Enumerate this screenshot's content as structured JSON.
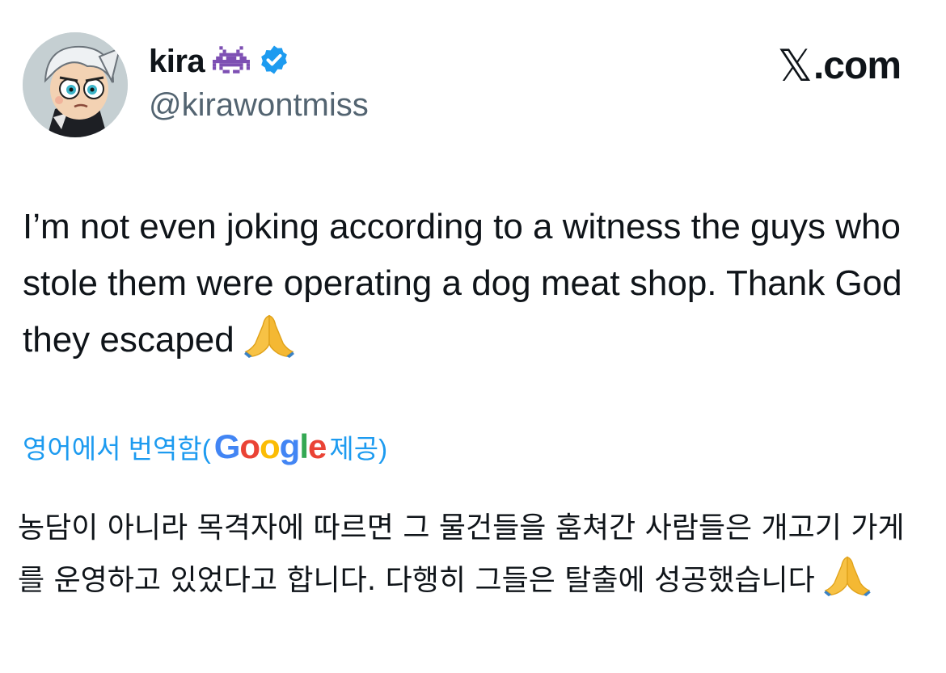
{
  "author": {
    "name": "kira",
    "handle": "@kirawontmiss",
    "name_emoji_icon": "space-invader-icon",
    "verified_icon": "verified-badge-icon",
    "verified_color": "#1d9bf0"
  },
  "brand": {
    "text": ".com",
    "icon": "x-logo-icon"
  },
  "tweet": {
    "text": "I’m not even joking according to a witness the guys who stole them were operating a dog meat shop. Thank God they escaped",
    "emoji_icon": "folded-hands-icon"
  },
  "translation": {
    "label_prefix": "영어에서 번역함(",
    "provider_letters": [
      "G",
      "o",
      "o",
      "g",
      "l",
      "e"
    ],
    "label_suffix": " 제공)",
    "text": "농담이 아니라 목격자에 따르면 그 물건들을 훔쳐간 사람들은 개고기 가게를 운영하고 있었다고 합니다. 다행히 그들은 탈출에 성공했습니다",
    "emoji_icon": "folded-hands-icon",
    "link_color": "#1d9bf0"
  },
  "colors": {
    "text": "#0f1419",
    "secondary": "#536471"
  }
}
